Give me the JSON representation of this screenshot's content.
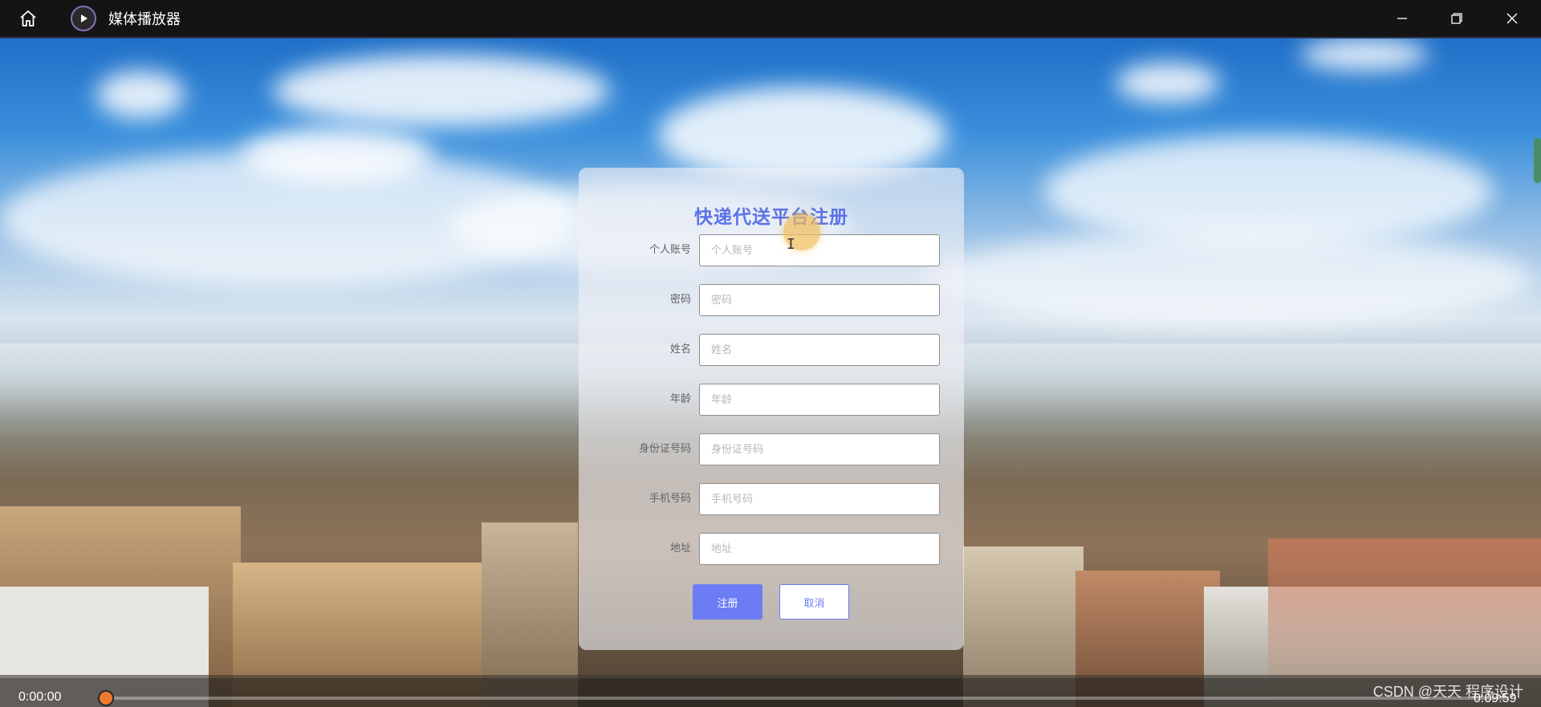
{
  "window": {
    "title": "媒体播放器",
    "icons": {
      "home": "home-icon",
      "app": "play-icon",
      "minimize": "minimize-icon",
      "restore": "restore-icon",
      "close": "close-icon"
    }
  },
  "form": {
    "title": "快递代送平台注册",
    "fields": [
      {
        "label": "个人账号",
        "placeholder": "个人账号",
        "value": ""
      },
      {
        "label": "密码",
        "placeholder": "密码",
        "value": ""
      },
      {
        "label": "姓名",
        "placeholder": "姓名",
        "value": ""
      },
      {
        "label": "年龄",
        "placeholder": "年龄",
        "value": ""
      },
      {
        "label": "身份证号码",
        "placeholder": "身份证号码",
        "value": ""
      },
      {
        "label": "手机号码",
        "placeholder": "手机号码",
        "value": ""
      },
      {
        "label": "地址",
        "placeholder": "地址",
        "value": ""
      }
    ],
    "register_label": "注册",
    "cancel_label": "取消"
  },
  "player": {
    "current_time": "0:00:00",
    "total_time": "0:09:59",
    "progress": 0
  },
  "watermark": "CSDN @天天 程序设计",
  "colors": {
    "accent": "#6c7cf5",
    "title": "#5b73e8",
    "seek_thumb": "#f07a2c"
  }
}
